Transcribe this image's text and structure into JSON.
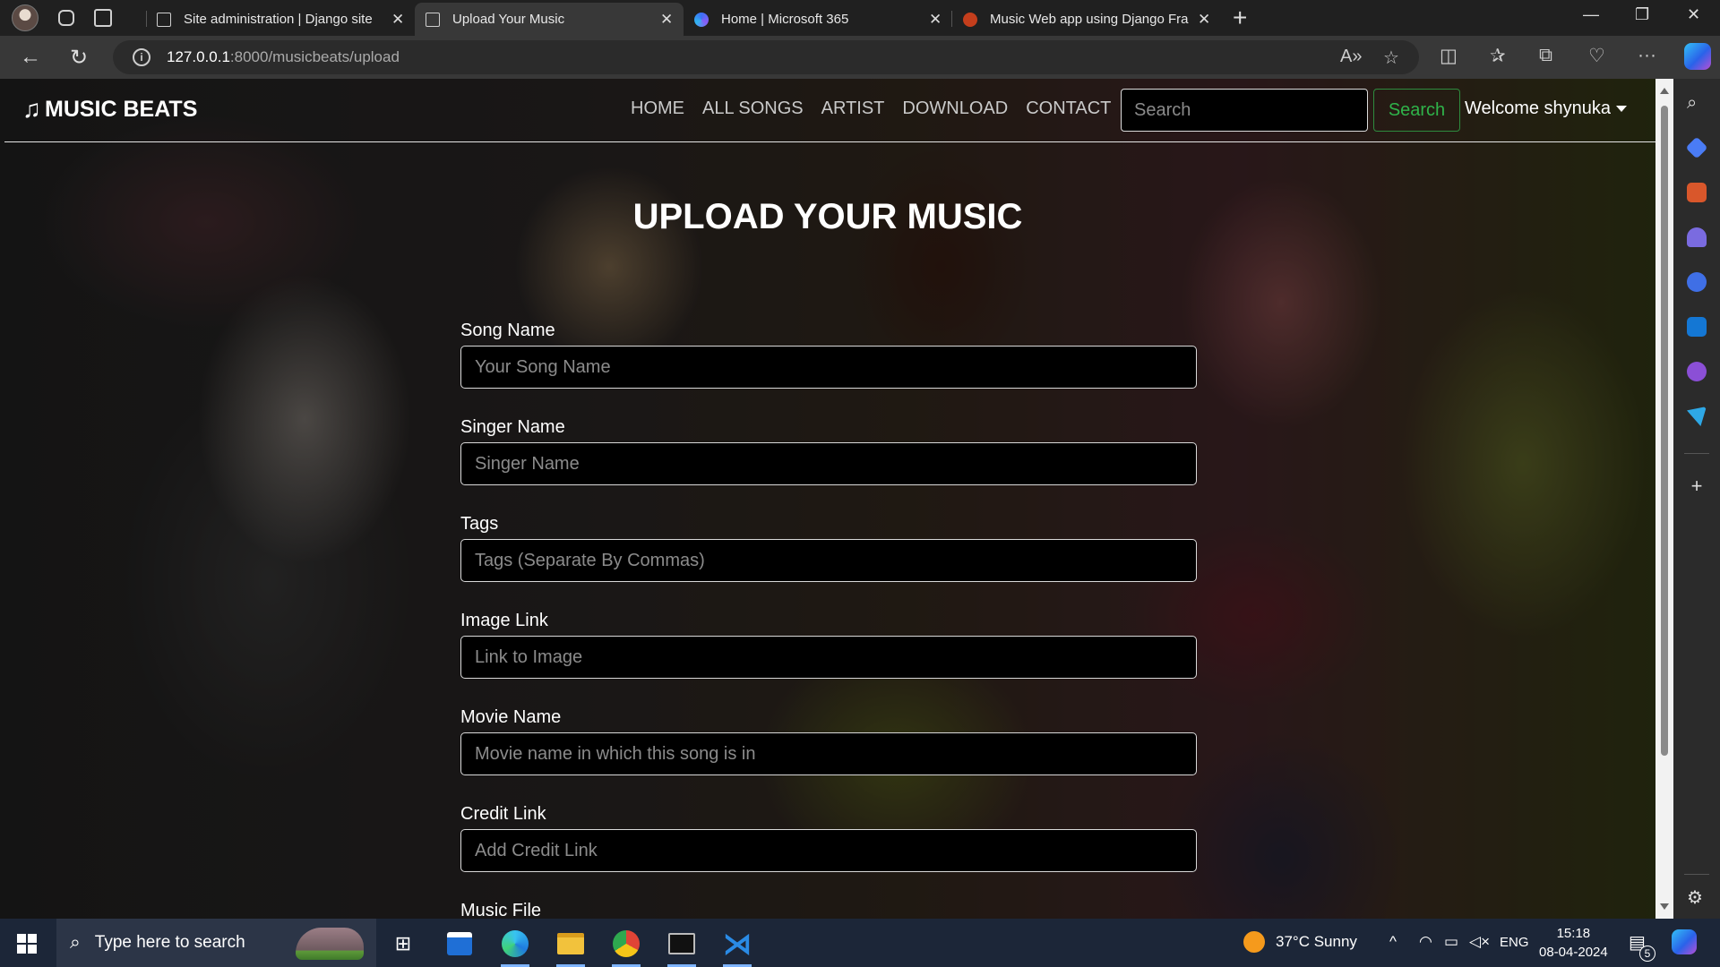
{
  "browser": {
    "tabs": [
      {
        "title": "Site administration | Django site",
        "active": false
      },
      {
        "title": "Upload Your Music",
        "active": true
      },
      {
        "title": "Home | Microsoft 365",
        "active": false
      },
      {
        "title": "Music Web app using Django Fra",
        "active": false
      }
    ],
    "url_host": "127.0.0.1",
    "url_path": ":8000/musicbeats/upload"
  },
  "site": {
    "brand": "MUSIC BEATS",
    "nav": [
      "HOME",
      "ALL SONGS",
      "ARTIST",
      "DOWNLOAD",
      "CONTACT"
    ],
    "search_placeholder": "Search",
    "search_button": "Search",
    "welcome": "Welcome shynuka"
  },
  "page": {
    "title": "UPLOAD YOUR MUSIC",
    "fields": [
      {
        "label": "Song Name",
        "placeholder": "Your Song Name"
      },
      {
        "label": "Singer Name",
        "placeholder": "Singer Name"
      },
      {
        "label": "Tags",
        "placeholder": "Tags (Separate By Commas)"
      },
      {
        "label": "Image Link",
        "placeholder": "Link to Image"
      },
      {
        "label": "Movie Name",
        "placeholder": "Movie name in which this song is in"
      },
      {
        "label": "Credit Link",
        "placeholder": "Add Credit Link"
      },
      {
        "label": "Music File",
        "placeholder": ""
      }
    ]
  },
  "taskbar": {
    "search_text": "Type here to search",
    "weather": "37°C  Sunny",
    "language": "ENG",
    "time": "15:18",
    "date": "08-04-2024",
    "notification_count": "5"
  },
  "colors": {
    "accent_green": "#2fb34a",
    "tab_active": "#383838",
    "taskbar": "#1c2638"
  }
}
